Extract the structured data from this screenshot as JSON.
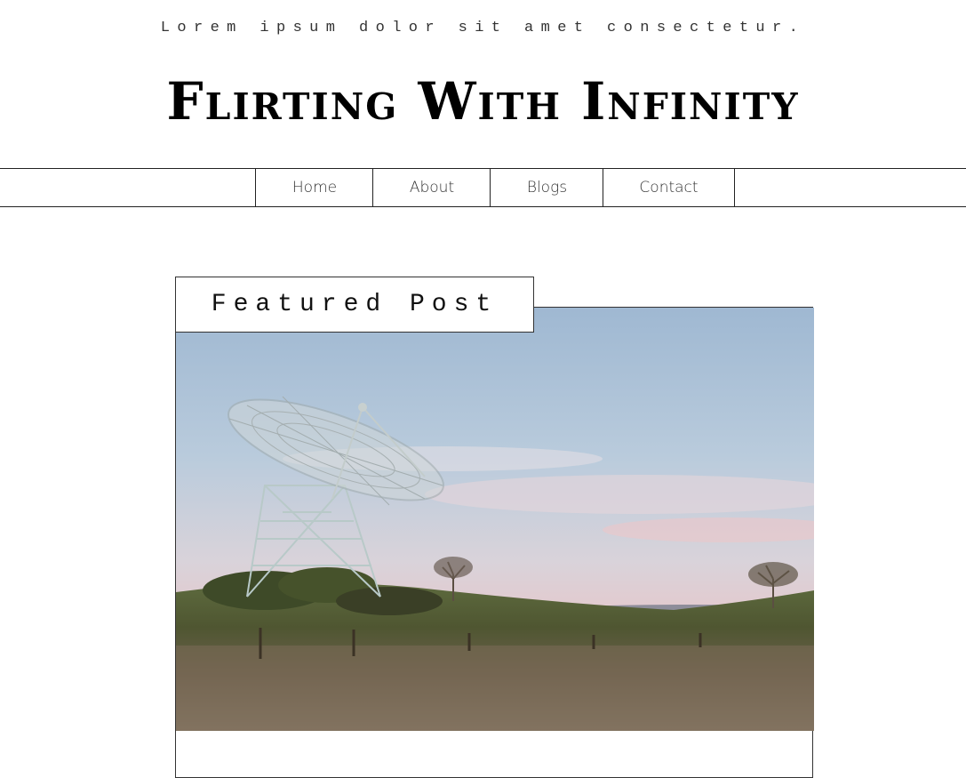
{
  "header": {
    "tagline": "Lorem ipsum dolor sit amet consectetur.",
    "title": "Flirting With Infinity"
  },
  "nav": {
    "items": [
      {
        "label": "Home"
      },
      {
        "label": "About"
      },
      {
        "label": "Blogs"
      },
      {
        "label": "Contact"
      }
    ]
  },
  "featured": {
    "label": "Featured Post",
    "image": {
      "subject": "radio-telescope-dish-in-grassy-field-at-dusk"
    }
  },
  "colors": {
    "text": "#111111",
    "border": "#222222",
    "background": "#ffffff"
  }
}
